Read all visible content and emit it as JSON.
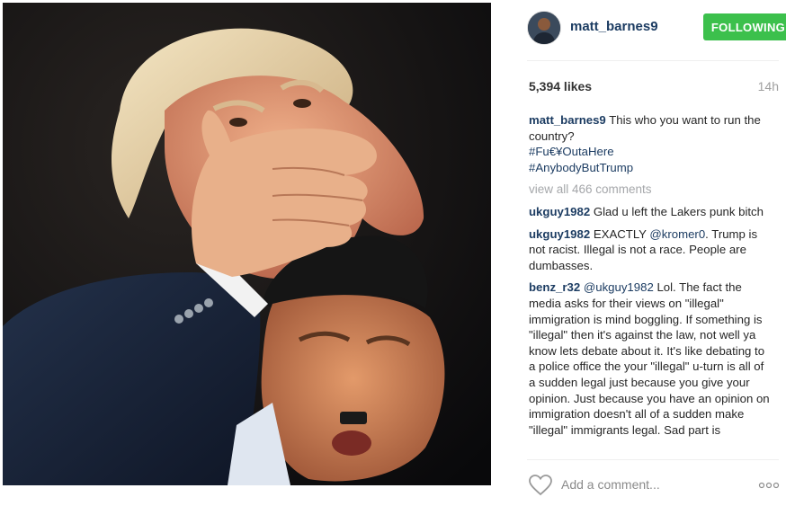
{
  "post": {
    "image_alt": "",
    "author": "matt_barnes9",
    "follow_label": "FOLLOWING",
    "likes": "5,394 likes",
    "time": "14h",
    "caption": {
      "user": "matt_barnes9",
      "text": " This who you want to run the country?",
      "hashtags": [
        "#Fu€¥OutaHere",
        "#AnybodyButTrump"
      ]
    },
    "view_all": "view all 466 comments",
    "comments": [
      {
        "user": "ukguy1982",
        "before": " Glad u left the Lakers punk bitch",
        "mention": "",
        "after": ""
      },
      {
        "user": "ukguy1982",
        "before": " EXACTLY ",
        "mention": "@kromer0",
        "after": ". Trump is not racist. Illegal is not a race. People are dumbasses."
      },
      {
        "user": "benz_r32",
        "before": " ",
        "mention": "@ukguy1982",
        "after": " Lol. The fact the media asks for their views on \"illegal\" immigration is mind boggling. If something is \"illegal\" then it's against the law, not well ya know lets debate about it. It's like debating to a police office the your \"illegal\" u-turn is all of a sudden legal just because you give your opinion. Just because you have an opinion on immigration doesn't all of a sudden make \"illegal\" immigrants legal. Sad part is"
      }
    ],
    "add_comment_placeholder": "Add a comment...",
    "icons": {
      "like": "heart-icon",
      "more": "more-options-icon"
    },
    "colors": {
      "follow": "#3cc04c",
      "link": "#1c3c62",
      "muted": "#a5a7aa"
    }
  }
}
